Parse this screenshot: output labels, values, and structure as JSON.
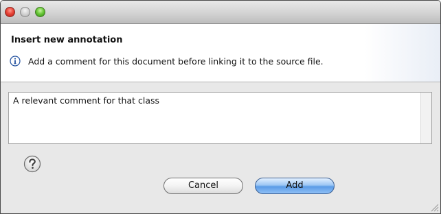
{
  "window": {
    "controls": [
      "close",
      "minimize",
      "zoom"
    ]
  },
  "header": {
    "title": "Insert new annotation",
    "message": "Add a comment for this document before linking it to the source file.",
    "icon": "info-icon"
  },
  "comment": {
    "value": "A relevant comment for that class"
  },
  "footer": {
    "help_icon": "question-mark-icon",
    "cancel_label": "Cancel",
    "add_label": "Add"
  },
  "colors": {
    "close": "#e8463a",
    "minimize": "#cfcfcf",
    "zoom": "#6cc93b",
    "default_button": "#5a9be6",
    "info_icon": "#1f4f9e"
  }
}
